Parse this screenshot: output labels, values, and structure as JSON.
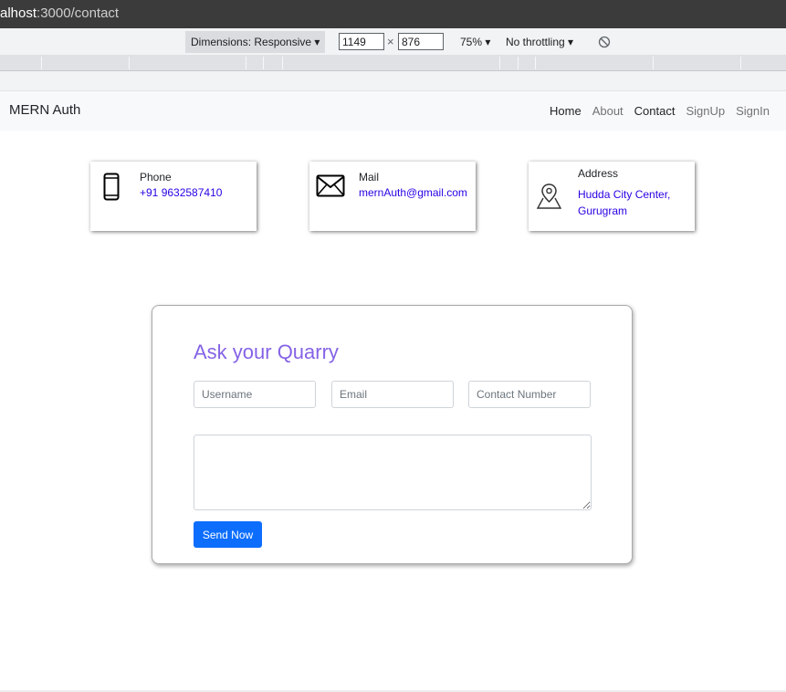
{
  "browser": {
    "url_host": "alhost",
    "url_rest": ":3000/contact",
    "dimensions_label": "Dimensions: Responsive",
    "width_value": "1149",
    "height_value": "876",
    "times": "×",
    "zoom": "75%",
    "throttling": "No throttling",
    "dropdown_arrow": "▾"
  },
  "navbar": {
    "brand": "MERN Auth",
    "links": [
      "Home",
      "About",
      "Contact",
      "SignUp",
      "SignIn"
    ]
  },
  "cards": [
    {
      "icon": "phone-icon",
      "title": "Phone",
      "value": "+91 9632587410"
    },
    {
      "icon": "mail-icon",
      "title": "Mail",
      "value": "mernAuth@gmail.com"
    },
    {
      "icon": "location-icon",
      "title": "Address",
      "value_line1": "Hudda City Center,",
      "value_line2": "Gurugram"
    }
  ],
  "form": {
    "title": "Ask your Quarry",
    "username_placeholder": "Username",
    "email_placeholder": "Email",
    "contact_placeholder": "Contact Number",
    "message_value": "",
    "submit_label": "Send Now"
  },
  "colors": {
    "accent_title": "#8563e6",
    "link_value": "#2900e3",
    "button": "#0d6efd"
  }
}
